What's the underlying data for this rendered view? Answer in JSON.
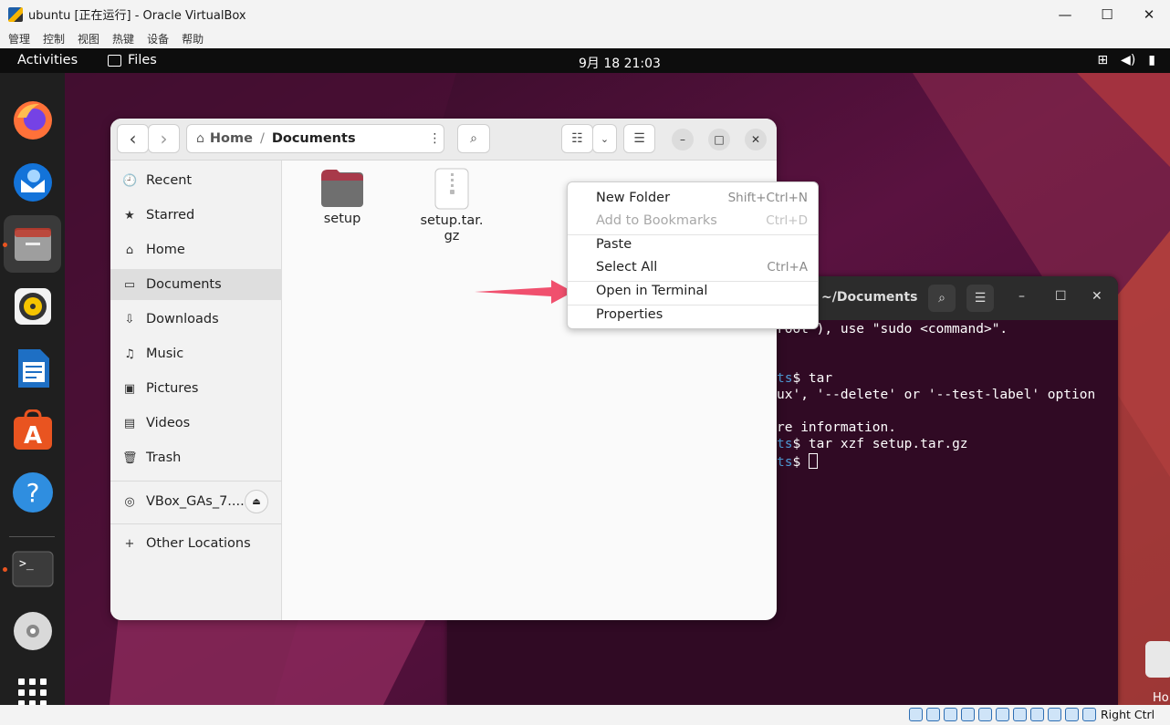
{
  "vbox": {
    "title": "ubuntu [正在运行] - Oracle VirtualBox",
    "menu": [
      "管理",
      "控制",
      "视图",
      "热键",
      "设备",
      "帮助"
    ],
    "win_min": "—",
    "win_max": "☐",
    "win_close": "✕",
    "host_key": "Right Ctrl"
  },
  "topbar": {
    "activities": "Activities",
    "app": "Files",
    "clock": "9月 18  21:03"
  },
  "files": {
    "back": "‹",
    "forward": "›",
    "path": [
      "Home",
      "/",
      "Documents"
    ],
    "sidebar": [
      {
        "icon": "🕘",
        "label": "Recent"
      },
      {
        "icon": "★",
        "label": "Starred"
      },
      {
        "icon": "⌂",
        "label": "Home"
      },
      {
        "icon": "▭",
        "label": "Documents"
      },
      {
        "icon": "⇩",
        "label": "Downloads"
      },
      {
        "icon": "♫",
        "label": "Music"
      },
      {
        "icon": "▣",
        "label": "Pictures"
      },
      {
        "icon": "▤",
        "label": "Videos"
      },
      {
        "icon": "🗑",
        "label": "Trash"
      }
    ],
    "device": "VBox_GAs_7....",
    "other_locations": "Other Locations",
    "items": [
      {
        "name": "setup",
        "type": "folder"
      },
      {
        "name": "setup.tar.\ngz",
        "type": "archive"
      }
    ]
  },
  "context_menu": [
    {
      "label": "New Folder",
      "accel": "Shift+Ctrl+N",
      "enabled": true
    },
    {
      "label": "Add to Bookmarks",
      "accel": "Ctrl+D",
      "enabled": false
    },
    {
      "label": "Paste",
      "accel": "",
      "enabled": true
    },
    {
      "label": "Select All",
      "accel": "Ctrl+A",
      "enabled": true
    },
    {
      "label": "Open in Terminal",
      "accel": "",
      "enabled": true
    },
    {
      "label": "Properties",
      "accel": "",
      "enabled": true
    }
  ],
  "terminal": {
    "title": "~/Documents",
    "lines": [
      {
        "prompt": "",
        "text": "root\"), use \"sudo <command>\"."
      },
      {
        "prompt": "ts",
        "text": "$ tar"
      },
      {
        "prompt": "",
        "text": "ux', '--delete' or '--test-label' option"
      },
      {
        "prompt": "",
        "text": "re information."
      },
      {
        "prompt": "ts",
        "text": "$ tar xzf setup.tar.gz"
      },
      {
        "prompt": "ts",
        "text": "$ "
      }
    ]
  },
  "desktop": {
    "home_label": "Ho"
  },
  "colors": {
    "accent": "#e95420",
    "terminal_bg": "#300a24",
    "arrow": "#f0506e"
  }
}
